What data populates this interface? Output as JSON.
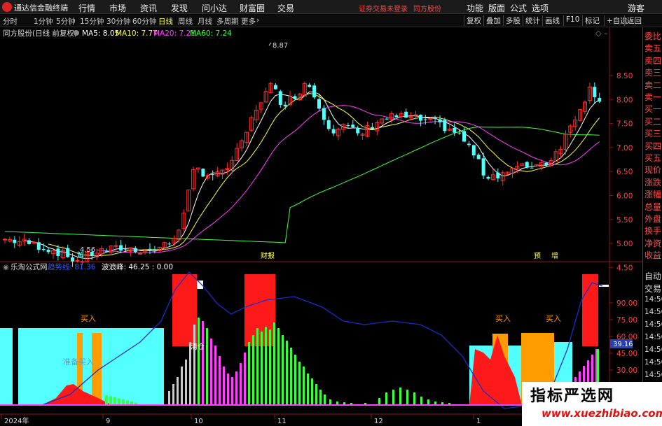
{
  "menubar": {
    "app_title": "通达信金融终端",
    "menus": [
      "行情",
      "市场",
      "资讯",
      "发现",
      "问小达",
      "财富圈",
      "交易"
    ],
    "warning": "证券交易未登录",
    "stock_name": "同方股份",
    "right_menus": [
      "功能",
      "版面",
      "公式",
      "选项"
    ],
    "guest": "游客"
  },
  "toolbar": {
    "periods": [
      "分时",
      "1分钟",
      "5分钟",
      "15分钟",
      "30分钟",
      "60分钟",
      "日线",
      "周线",
      "月线",
      "多周期",
      "更多"
    ],
    "active_period": "日线",
    "right_buttons": [
      "复权",
      "叠加",
      "多股",
      "统计",
      "画线",
      "F10",
      "标记",
      "+自选",
      "返回"
    ]
  },
  "main_chart": {
    "title": "同方股份(日线 前复权)",
    "ma_labels": [
      "MA5: 8.05",
      "MA10: 7.77",
      "MA20: 7.21",
      "MA60: 7.24"
    ],
    "ma_colors": [
      "#ffffff",
      "#ffff40",
      "#ff40ff",
      "#40ff40"
    ],
    "price_axis": [
      "8.50",
      "8.00",
      "7.50",
      "7.00",
      "6.50",
      "6.00",
      "5.50",
      "5.00",
      "4.50"
    ],
    "high_label": "8.87",
    "low_label": "4.56",
    "events": [
      "财报",
      "预",
      "增"
    ],
    "marker_jie": "解",
    "up_color": "#ff3030",
    "down_color": "#54ffff"
  },
  "indicator": {
    "title": "乐淘公式网",
    "line1": "趋势线: 81.36",
    "line2": "波浪峰: 46.25 : 0.00",
    "axis": [
      "90.00",
      "75.00",
      "60.00",
      "45.00",
      "30.00"
    ],
    "current_value": "39.16",
    "buy_labels": [
      "买入",
      "买入",
      "买入"
    ],
    "text_zhunbei": "准备买入",
    "text_qingcang": "清仓"
  },
  "time_axis": [
    "2024年",
    "9",
    "10",
    "11",
    "12",
    "1"
  ],
  "side_panel": {
    "top_labels": [
      "委比",
      "卖五",
      "卖四",
      "卖三",
      "卖二",
      "卖一",
      "买一",
      "买二",
      "买三",
      "买四",
      "买五",
      "现价",
      "涨跌",
      "涨幅",
      "总量",
      "外盘",
      "换手",
      "净资",
      "收益"
    ],
    "bottom_labels": [
      "自动",
      "交易",
      "14:56",
      "14:56",
      "14:56",
      "14:56",
      "14:56",
      "14:56",
      "14:56",
      "14:56"
    ]
  },
  "watermark": {
    "title": "指标严选网",
    "url": "www.xuezhibiao.com"
  }
}
